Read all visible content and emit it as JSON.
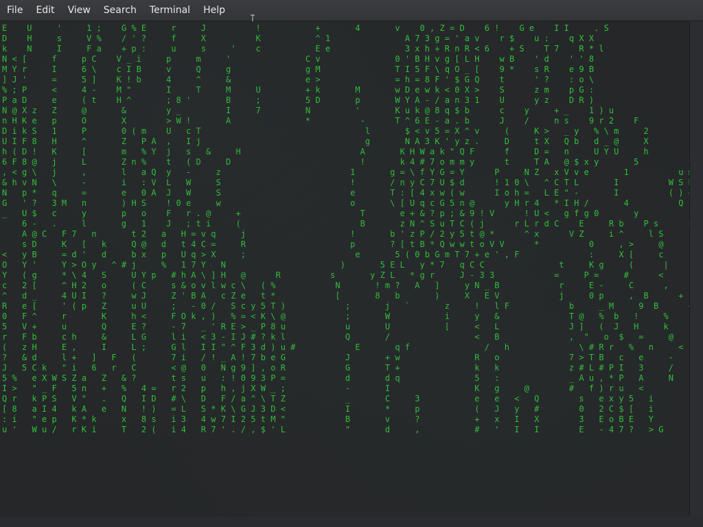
{
  "menubar": {
    "items": [
      "File",
      "Edit",
      "View",
      "Search",
      "Terminal",
      "Help"
    ]
  },
  "terminal": {
    "theme_color": "#30c43a",
    "highlight_color": "#e8e8e8",
    "content": "E    U     '     1 ;    G % E     r     J          !           +       4       v    0 , Z = D    6 !    G e    I I     . S                       N\nD    H     s     V %    / ' ?     f     X          K           ^ 1               A 7 3 g = ' a v    r $    u :    q X X                     4\nk    N     I     F a    + p :     u     s     '    c           E e               3 x h + R n R < 6    + S    T 7    R * l                     k\nN < [     f     p C    V _ i     p     m     '               C v               0 ' B H v g [ L H    w B    ' d    ' ' 8                     D\nM Y r     I     6 \\    c I B     v     Q     g               g M               T I 5 F \\ q O _ [    9 *    s R    e 9 B                     L\n] J '     =     5 ]    K ! b     4     ^     &               e >               = h = 8 F ' $ G Q    t      ' ?    : o \\                     )\n% ; P     <     4 -    M \"       I     T     M     U         + k       M       w D e w k < 0 X >    S      z m    p G :                     9\nP a D     e     ( t    H ^       ; 8 '       B     ;         5 D       p       W Y A - / a n 3 1    U      y z    D R )                     @\nN @ X z   Z     @       &        y _         I     7         N         '       K u k @ 8 q $ b      c    y     + _    1 ) u                     v\nn H K e   p     O       X        > W !       A               *          -      T ^ 6 E - a . b      J    /     n s    9 r 2    F           j r l\nD i k S   1     P       0 ( m    U   c T                                 l       $ < v 5 = X ^ v     (     K >   _ y   % \\ m     2          ' Z d\nU I F 8   H     ^       Z   P A  ,   I j                                 g       N A 3 K ' y z .     D     t X   Q b   d _ @     X          T D t\nh ( D !   K     [       m   % Y  j   s   &     H                        A       K H W a k \" Q F      f     D =   n     U Y U     h          e\n6 F 8 @   j     L       Z n %    t   ( D     D                          !       k 4 # 7 o m m y      t     T A   @ $ x y       5          t [ n\n, < g \\   j     ,       l   a Q  y   -     z                          1       g = \\ f Y G = Y      P     N Z   x V v e       1          u m 9\n& h v N   \\     -       i   : V  L   W     S                          !       / n y C 7 U $ d      ! 1 0 \\   ^ C T L       I          W S K\nN   p *   q     =       e   0 A  J   W     S                          e       T : [ 4 x w ( w      I o h =   L E \" -       I          ( ) e\nG   ' ?   3 M   n       ) H S    ! 0 e     w                          o       \\ [ U q c G 5 n @      y H r 4   * I H /       4          Q $ b\n_   U $   c     y       p   o    F   r . @     +                        T       e + & ? p ; & 9 ! V      ! U <   g f g 0       y          ! K >\n    6 -   .     l       g   1    J   ; t i     (                        B       z N ^ S u T C ( j      r L r d C    E     R b    P s      P\n    A @ C   F 7   n       t 2   a   H = v q     j                     !       b ' z P / 2 y 5 t @ *      ^ x      V Z     i ^     l S      $\n    s D     K   [   k     Q @   d   t 4 C =     R                     p       ? [ t B * Q w w t o V V      *          0     , >     @      g\n<   y B     = d '   d     b x   p   U q > X     ;                      e       5 ( 0 b G m T 7 + e ' , F              :     X [     c      (\nO   Y '     Y > O y   ^ # j     %   1 7 Y   N                       )       5 E L   y * 7   q C C               t     K g     (      |\nY   ( g     * \\ 4   S     U Y p   # h A \\ ] H   @      R          s       y Z L   * g r     J - 3 3            =     P =     #      <\nc   2 [     ^ H 2   o     ( C     s & o v l w c \\   ( %            N       ! m ?   A   ]     y N _ B            r     E -     C      ,\n^   d _     4 U I   ?     w J     Z ' B A   c Z e   t *            [       8   b       )     X   E V            j     0 p     ,  B      +\nR   e [     ' ( p   Z     u U     ;   - 0 /   S c y 5 T )            ;       j   `       z     !   l F            b     _ M     9  B      <\n0   F ^     r       K     h <     F O k , )   % = < K \\ @            ;       W           i     y   &              T @   %  b   !     %\n5   V +     u       Q     E ?     - 7   _ ' R E > _ P 8 u            u       U           [     <   L              J ]   (  J   H     k\nr   F b     c h     &     L G     l i   < 3 - I J # ? k l            Q       /                 <   B              ,  \"   o  $   =     @\n(   z H     E ,     I     L ;     G l   I I \" ^ F 3 d ) u #            E       q f               /   h              \\ # R r   %   n     <\n?   & d     l +   ]   F   (       7 i   / ! _ A ! 7 b e G            J       + w               R   o              7 > T B   c   e     -\nJ   5 C k   \" i   6   r   C       < @   0   N g 9 ] , o R            G       T +               k   k              z # L # P I   3     /\n5 %   e X W S Z a   Z   & ?       t s   u   : ! 0 9 3 P =            d       d q               5   :              _ A u , * P   A     N\nI >   \" _ F   5 n   +   %   4 =   r 2   p   h , j X W _ ;            -       I                 K   g     @        #   f ) r u   <\nQ r   k P S   V \"   .   Q   I D   # \\   D   F / a ^ \\ T Z            _       C     3           e   e   <   Q        s   e x y 5   i\n[ 8   a I 4   k A   e   N   ! )   = L   S * K \\ G J 3 D <            I       *     p           (   J   y   #        0   2 C $ [   i\n: i   \" e p   K * k     x   8 s   i 3   4 w 7 I 2 5 t M \"            B       v     ?           +   x   I   X        3   E o B E   Y\nu '   W u /   r K i     T   2 (   i 4   R 7 ' . / , $ ' L            \"       d     ,           #   '   I   I        E   - 4 7 ?   > G"
  }
}
